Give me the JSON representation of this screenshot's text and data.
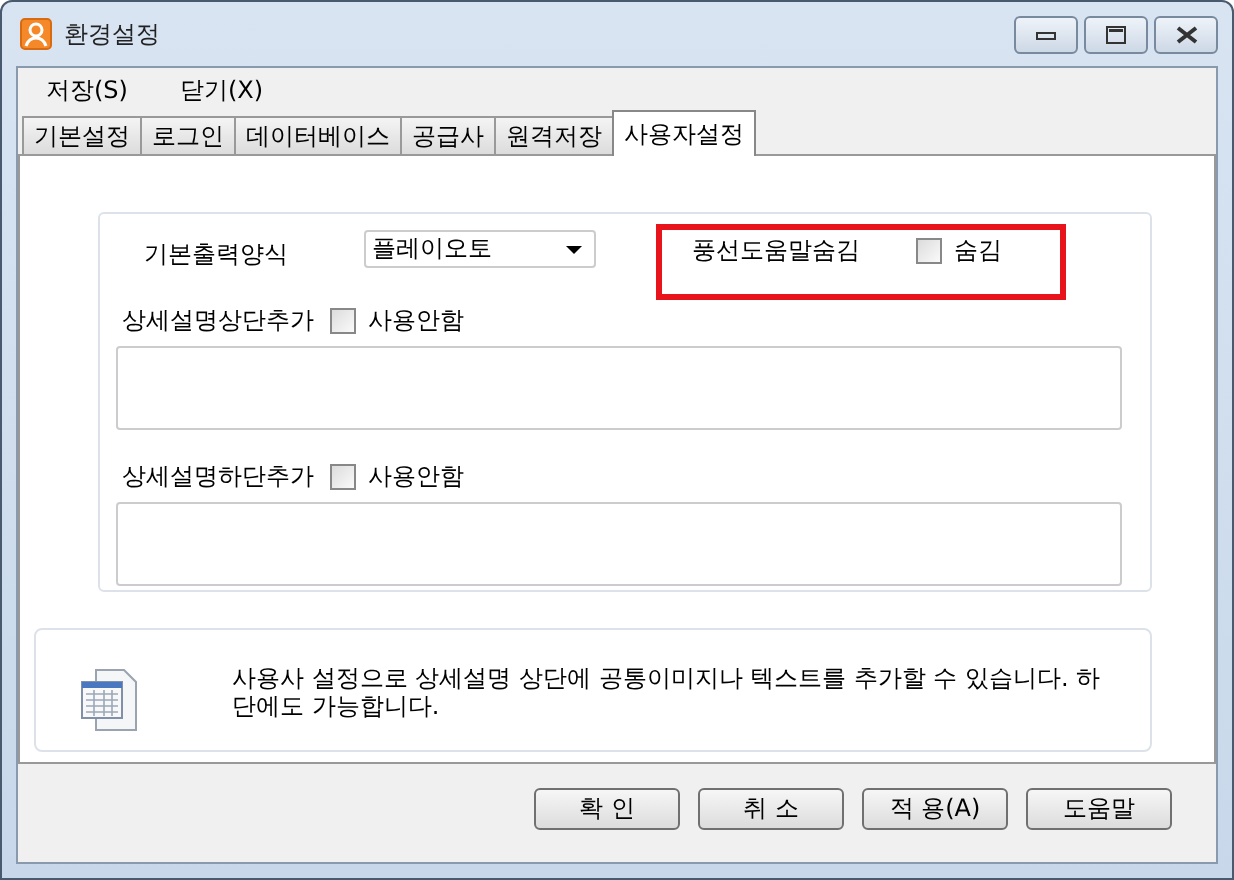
{
  "window": {
    "title": "환경설정"
  },
  "menu": [
    "저장(S)",
    "닫기(X)"
  ],
  "tabs": [
    {
      "label": "기본설정",
      "selected": false
    },
    {
      "label": "로그인",
      "selected": false
    },
    {
      "label": "데이터베이스",
      "selected": false
    },
    {
      "label": "공급사",
      "selected": false
    },
    {
      "label": "원격저장",
      "selected": false
    },
    {
      "label": "사용자설정",
      "selected": true
    }
  ],
  "form": {
    "output_format": {
      "label": "기본출력양식",
      "value": "플레이오토"
    },
    "balloon_help": {
      "label": "풍선도움말숨김",
      "option": "숨김",
      "checked": false,
      "highlighted": true
    },
    "header_add": {
      "label": "상세설명상단추가",
      "option": "사용안함",
      "checked": false
    },
    "footer_add": {
      "label": "상세설명하단추가",
      "option": "사용안함",
      "checked": false
    }
  },
  "info": "사용사 설정으로 상세설명 상단에 공통이미지나 텍스트를 추가할 수 있습니다. 하단에도 가능합니다.",
  "buttons": [
    "확 인",
    "취 소",
    "적 용(A)",
    "도움말"
  ]
}
